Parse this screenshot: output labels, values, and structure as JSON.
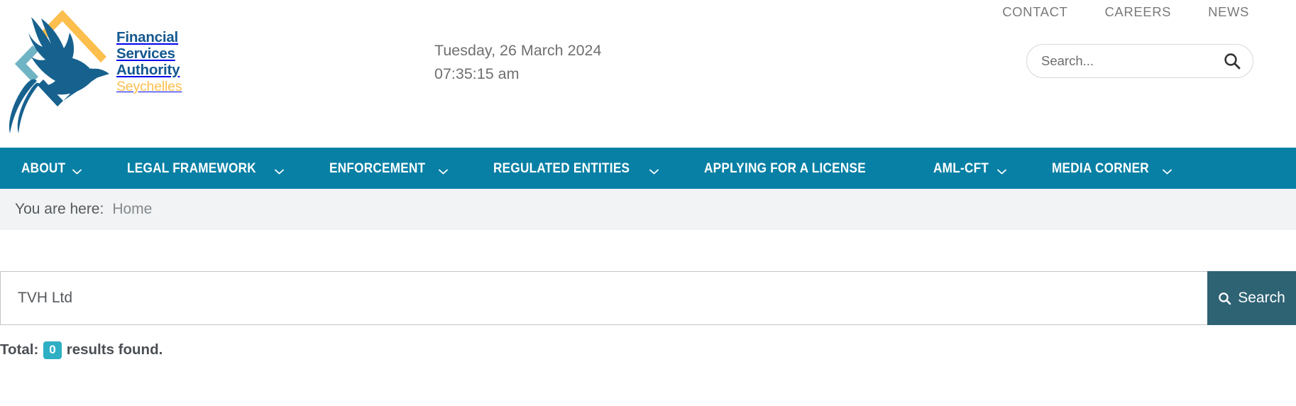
{
  "brand": {
    "logo_icon": "fsa-seychelles-tropicbird-logo",
    "lines": [
      "Financial",
      "Services",
      "Authority"
    ],
    "subtitle": "Seychelles",
    "text_color": "#14588f",
    "subtitle_color": "#fcbe4d"
  },
  "header": {
    "date": "Tuesday, 26 March 2024",
    "time": "07:35:15 am",
    "top_links": [
      {
        "label": "CONTACT"
      },
      {
        "label": "CAREERS"
      },
      {
        "label": "NEWS"
      }
    ],
    "search": {
      "value": "",
      "placeholder": "Search...",
      "icon": "search-icon"
    }
  },
  "mainnav": {
    "background": "#0880a5",
    "items": [
      {
        "label": "ABOUT",
        "has_dropdown": true
      },
      {
        "label": "LEGAL FRAMEWORK",
        "has_dropdown": true
      },
      {
        "label": "ENFORCEMENT",
        "has_dropdown": true
      },
      {
        "label": "REGULATED ENTITIES",
        "has_dropdown": true
      },
      {
        "label": "APPLYING FOR A LICENSE",
        "has_dropdown": false
      },
      {
        "label": "AML-CFT",
        "has_dropdown": true
      },
      {
        "label": "MEDIA CORNER",
        "has_dropdown": true
      }
    ]
  },
  "breadcrumb": {
    "prefix": "You are here:",
    "current": "Home"
  },
  "main_search": {
    "value": "TVH Ltd",
    "placeholder": "",
    "button_label": "Search",
    "button_icon": "search-icon",
    "button_color": "#2e6374"
  },
  "results": {
    "prefix": "Total:",
    "count": "0",
    "suffix": "results found.",
    "badge_color": "#2eafc4"
  }
}
